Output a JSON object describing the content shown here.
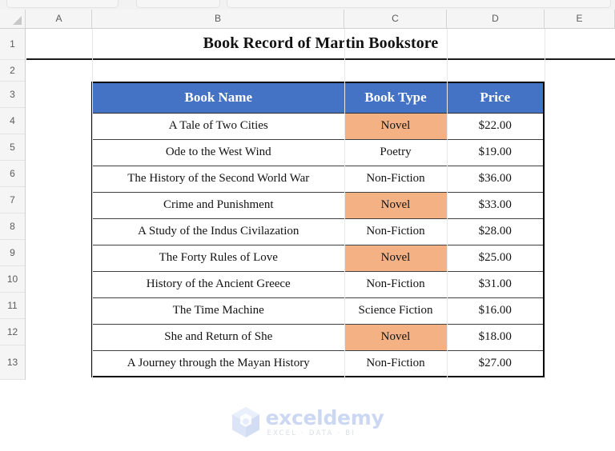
{
  "app": {
    "type": "spreadsheet",
    "ribbon_groups_visible": 3
  },
  "grid": {
    "column_headers": [
      "A",
      "B",
      "C",
      "D",
      "E"
    ],
    "row_headers": [
      "1",
      "2",
      "3",
      "4",
      "5",
      "6",
      "7",
      "8",
      "9",
      "10",
      "11",
      "12",
      "13"
    ],
    "select_all_icon": "select-all-triangle-icon"
  },
  "sheet": {
    "title": "Book Record of Martin Bookstore"
  },
  "table": {
    "headers": [
      "Book Name",
      "Book Type",
      "Price"
    ],
    "rows": [
      {
        "name": "A Tale of Two Cities",
        "type": "Novel",
        "price": "$22.00",
        "highlight": true
      },
      {
        "name": "Ode to the West Wind",
        "type": "Poetry",
        "price": "$19.00",
        "highlight": false
      },
      {
        "name": "The History of the Second World War",
        "type": "Non-Fiction",
        "price": "$36.00",
        "highlight": false
      },
      {
        "name": "Crime and Punishment",
        "type": "Novel",
        "price": "$33.00",
        "highlight": true
      },
      {
        "name": "A Study of the Indus Civilazation",
        "type": "Non-Fiction",
        "price": "$28.00",
        "highlight": false
      },
      {
        "name": "The Forty Rules of Love",
        "type": "Novel",
        "price": "$25.00",
        "highlight": true
      },
      {
        "name": "History of the Ancient Greece",
        "type": "Non-Fiction",
        "price": "$31.00",
        "highlight": false
      },
      {
        "name": "The Time Machine",
        "type": "Science Fiction",
        "price": "$16.00",
        "highlight": false
      },
      {
        "name": "She and Return of She",
        "type": "Novel",
        "price": "$18.00",
        "highlight": true
      },
      {
        "name": "A Journey through the Mayan History",
        "type": "Non-Fiction",
        "price": "$27.00",
        "highlight": false
      }
    ]
  },
  "watermark": {
    "wordmark": "exceldemy",
    "tagline": "EXCEL · DATA · BI",
    "logo_icon": "exceldemy-cube-logo-icon"
  },
  "colors": {
    "header_blue": "#4472C4",
    "highlight_orange": "#F4B183",
    "header_text": "#FFFFFF",
    "cell_text": "#131313",
    "table_border": "#0A0A0A",
    "gutter_bg": "#F5F5F5",
    "watermark_blue": "#CCD8F2"
  }
}
